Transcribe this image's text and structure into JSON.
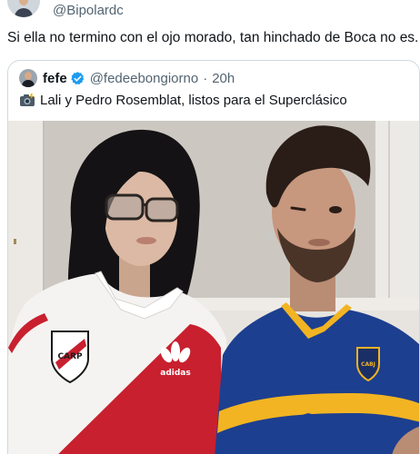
{
  "author": {
    "handle": "@Bipolardc"
  },
  "tweet": {
    "text": "Si ella no termino con el ojo morado, tan hinchado de Boca no es."
  },
  "quoted_tweet": {
    "display_name": "fefe",
    "handle": "@fedeebongiorno",
    "separator": "·",
    "time": "20h",
    "text": "Lali y Pedro Rosemblat, listos para el Superclásico",
    "verified_color": "#1d9bf0",
    "text_icon": "camera-with-flash-icon"
  },
  "photo": {
    "shirt_left_badge": "CARP",
    "shirt_left_brand": "adidas",
    "shirt_right_badge": "CABJ"
  }
}
